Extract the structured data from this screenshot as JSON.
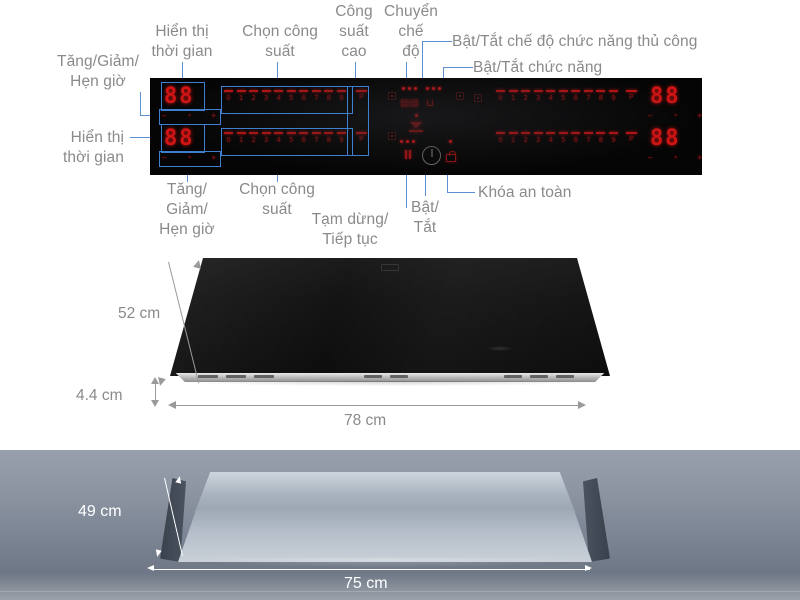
{
  "annotations": {
    "tang_giam_hen_gio_top": "Tăng/Giảm/\nHẹn giờ",
    "hien_thi_thoi_gian_top": "Hiển thị\nthời gian",
    "chon_cong_suat_top": "Chọn công\nsuất",
    "cong_suat_cao": "Công\nsuất\ncao",
    "chuyen_che_do": "Chuyển\nchế\nđộ",
    "bat_tat_che_do_thu_cong": "Bật/Tắt chế độ chức năng thủ công",
    "bat_tat_chuc_nang": "Bật/Tắt chức năng",
    "hien_thi_thoi_gian_bottom": "Hiển thị\nthời gian",
    "tang_giam_hen_gio_bottom": "Tăng/\nGiảm/\nHẹn giờ",
    "chon_cong_suat_bottom": "Chọn công\nsuất",
    "tam_dung_tiep_tuc": "Tạm dừng/\nTiếp tục",
    "bat_tat": "Bật/\nTắt",
    "khoa_an_toan": "Khóa an toàn"
  },
  "panel": {
    "timer_display_top": "88",
    "timer_display_bottom": "88",
    "timer_display_right_top": "88",
    "timer_display_right_bottom": "88",
    "minus": "–",
    "plus": "+",
    "clock_icon": "⏱",
    "slider_levels": [
      "0",
      "1",
      "2",
      "3",
      "4",
      "5",
      "6",
      "7",
      "8",
      "9"
    ],
    "boost_label": "P",
    "mode_icon_label": "mode-switch-icon",
    "function_icon_label": "manual-function-icon",
    "pause_icon_label": "pause-icon",
    "power_icon_label": "power-icon",
    "lock_icon_label": "lock-icon"
  },
  "cooktop_dimensions": {
    "depth": "52 cm",
    "height": "4.4 cm",
    "width": "78 cm"
  },
  "cutout_dimensions": {
    "depth": "49 cm",
    "width": "75 cm"
  },
  "colors": {
    "accent_blue": "#3f7fd0",
    "label_grey": "#8a8a8a",
    "led_red": "#d31414",
    "panel_black": "#050505"
  }
}
